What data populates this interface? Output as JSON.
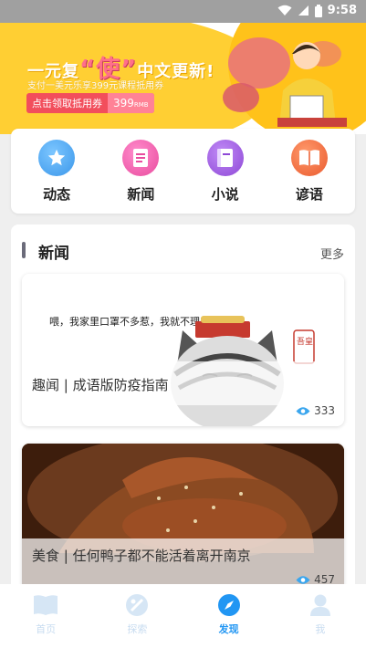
{
  "status_bar": {
    "time": "9:58"
  },
  "banner": {
    "headline_pre": "一元复",
    "headline_big": "“使”",
    "headline_post": "中文更新!",
    "subtitle": "支付一美元乐享399元课程抵用券",
    "cta_label": "点击领取抵用券",
    "cta_price": "399",
    "cta_currency": "RMB"
  },
  "categories": [
    {
      "label": "动态",
      "icon": "star-icon",
      "color": "#4aa8ef"
    },
    {
      "label": "新闻",
      "icon": "document-icon",
      "color": "#ef5aa8"
    },
    {
      "label": "小说",
      "icon": "book-icon",
      "color": "#9b59e0"
    },
    {
      "label": "谚语",
      "icon": "open-book-icon",
      "color": "#f26a3c"
    }
  ],
  "news": {
    "title": "新闻",
    "more": "更多",
    "items": [
      {
        "caption": "趣闻 | 成语版防疫指南",
        "views": "333",
        "image_text": "喂，我家里口罩不多惹，我就不理来了。",
        "stamp": "吾皇"
      },
      {
        "caption": "美食 | 任何鸭子都不能活着离开南京",
        "views": "457"
      }
    ]
  },
  "tabbar": [
    {
      "label": "首页",
      "icon": "home-book-icon",
      "active": false
    },
    {
      "label": "探索",
      "icon": "explore-icon",
      "active": false
    },
    {
      "label": "发现",
      "icon": "compass-icon",
      "active": true
    },
    {
      "label": "我",
      "icon": "user-icon",
      "active": false
    }
  ]
}
